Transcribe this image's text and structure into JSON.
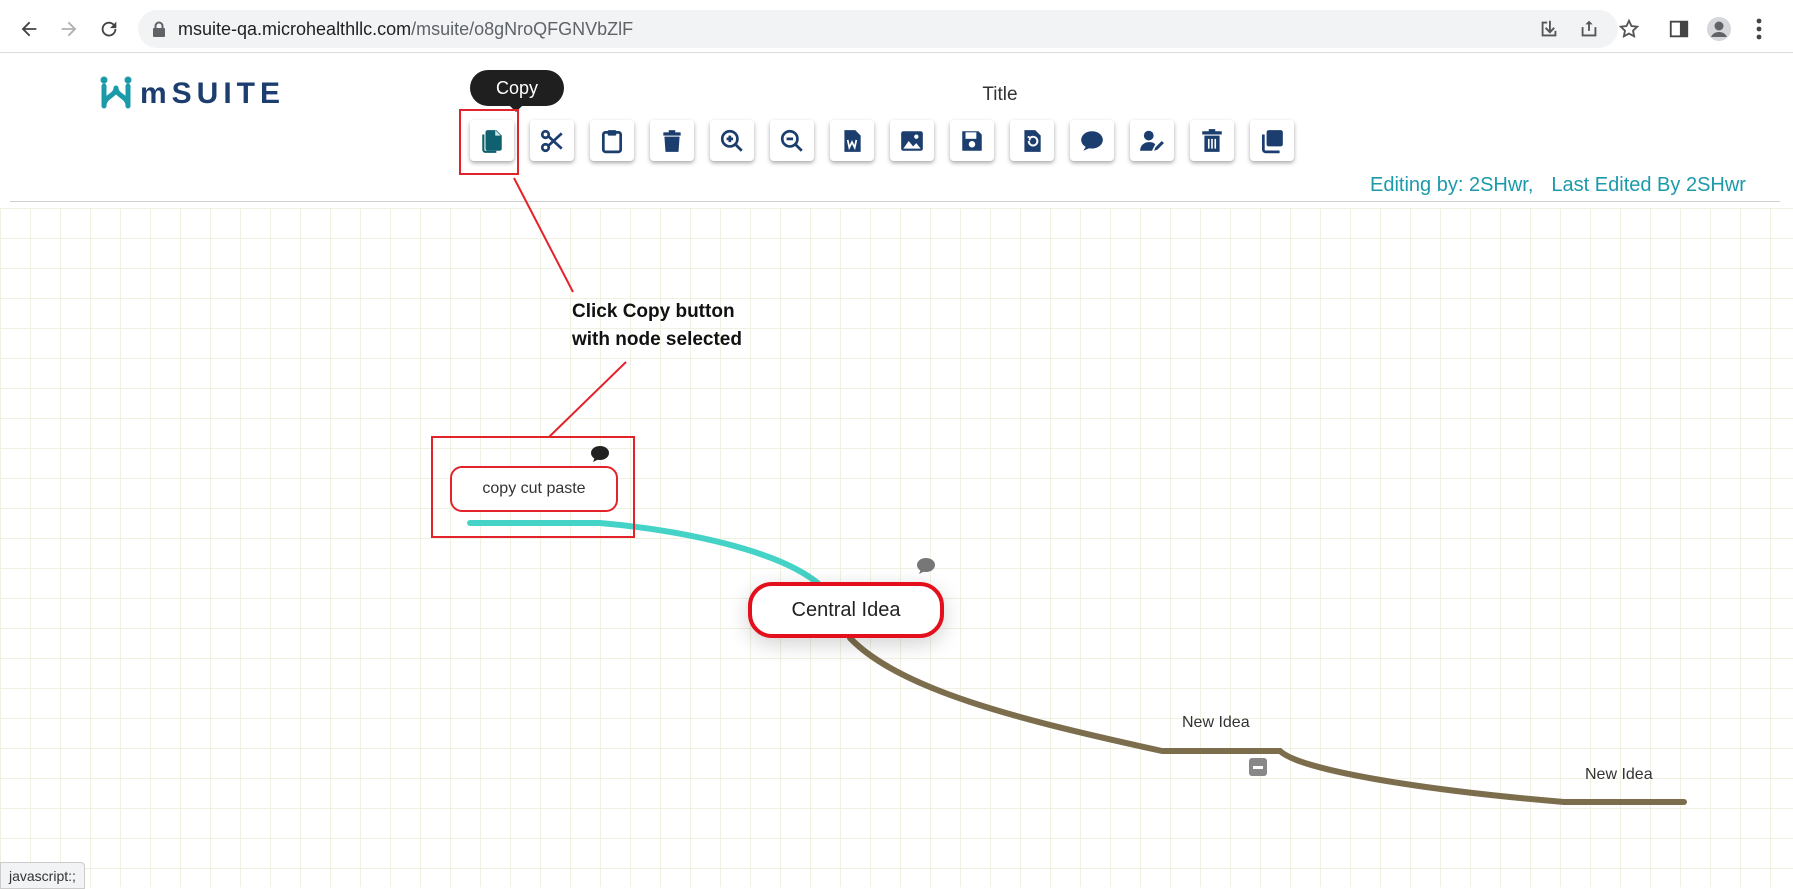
{
  "browser": {
    "url_host": "msuite-qa.microhealthllc.com",
    "url_path": "/msuite/o8gNroQFGNVbZlF",
    "status_text": "javascript:;"
  },
  "app": {
    "logo_text": "mSUITE",
    "title": "Title",
    "tooltip": "Copy",
    "editing_by": "Editing by: 2SHwr,",
    "last_edited": "Last Edited By 2SHwr",
    "brand_color": "#1b9aaa",
    "icon_color": "#1c3e6e"
  },
  "toolbar": {
    "buttons": [
      "copy",
      "cut",
      "paste",
      "delete",
      "zoom-in",
      "zoom-out",
      "export-word",
      "export-image",
      "save",
      "reset",
      "comment",
      "edit-user",
      "trash",
      "duplicate"
    ]
  },
  "annotation": {
    "line1": "Click Copy button",
    "line2": "with node selected"
  },
  "map": {
    "selected_node": "copy cut paste",
    "central": "Central Idea",
    "idea1": "New Idea",
    "idea2": "New Idea"
  }
}
